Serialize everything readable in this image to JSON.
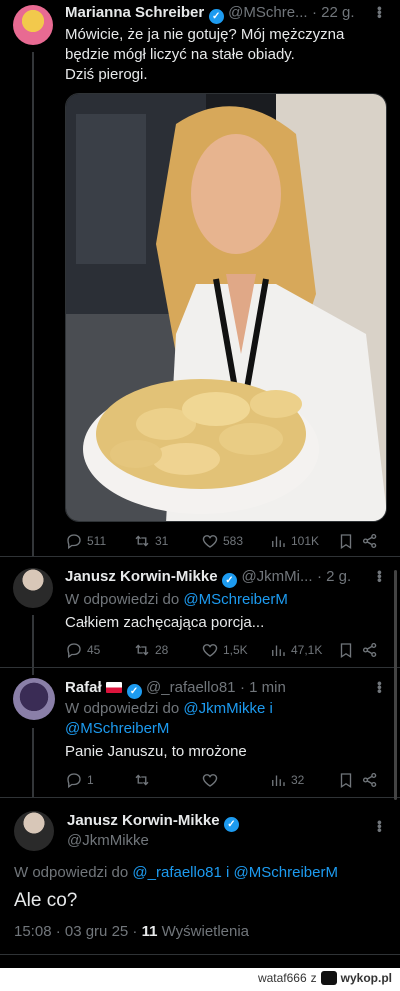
{
  "tweets": [
    {
      "name": "Marianna Schreiber",
      "handle": "@MSchre...",
      "time": "· 22 g.",
      "text_lines": [
        "Mówicie, że ja nie gotuję? Mój mężczyzna",
        "będzie mógł liczyć na stałe obiady.",
        "Dziś pierogi."
      ],
      "stats": {
        "replies": "511",
        "reposts": "31",
        "likes": "583",
        "views": "101K"
      }
    },
    {
      "name": "Janusz Korwin-Mikke",
      "handle": "@JkmMi...",
      "time": "· 2 g.",
      "reply_prefix": "W odpowiedzi do",
      "reply_to": "@MSchreiberM",
      "text": "Całkiem zachęcająca porcja...",
      "stats": {
        "replies": "45",
        "reposts": "28",
        "likes": "1,5K",
        "views": "47,1K"
      }
    },
    {
      "name": "Rafał",
      "handle": "@_rafaello81",
      "time": "· 1 min",
      "reply_prefix": "W odpowiedzi do",
      "reply_to_1": "@JkmMikke",
      "reply_and": "i",
      "reply_to_2": "@MSchreiberM",
      "text": "Panie Januszu, to mrożone",
      "stats": {
        "replies": "1",
        "reposts": "",
        "likes": "",
        "views": "32"
      }
    },
    {
      "name": "Janusz Korwin-Mikke",
      "handle": "@JkmMikke",
      "reply_prefix": "W odpowiedzi do",
      "reply_to_1": "@_rafaello81",
      "reply_and": "i",
      "reply_to_2": "@MSchreiberM",
      "text": "Ale co?",
      "meta_time": "15:08 · 03 gru 25 ·",
      "meta_views": "11",
      "meta_views_label": "Wyświetlenia"
    }
  ],
  "footer": {
    "user": "wataf666",
    "sep": "z",
    "site": "wykop.pl"
  },
  "colors": {
    "bg": "#000000",
    "text": "#e7e9ea",
    "muted": "#71767b",
    "link": "#1d9bf0",
    "verified": "#1d9bf0"
  }
}
